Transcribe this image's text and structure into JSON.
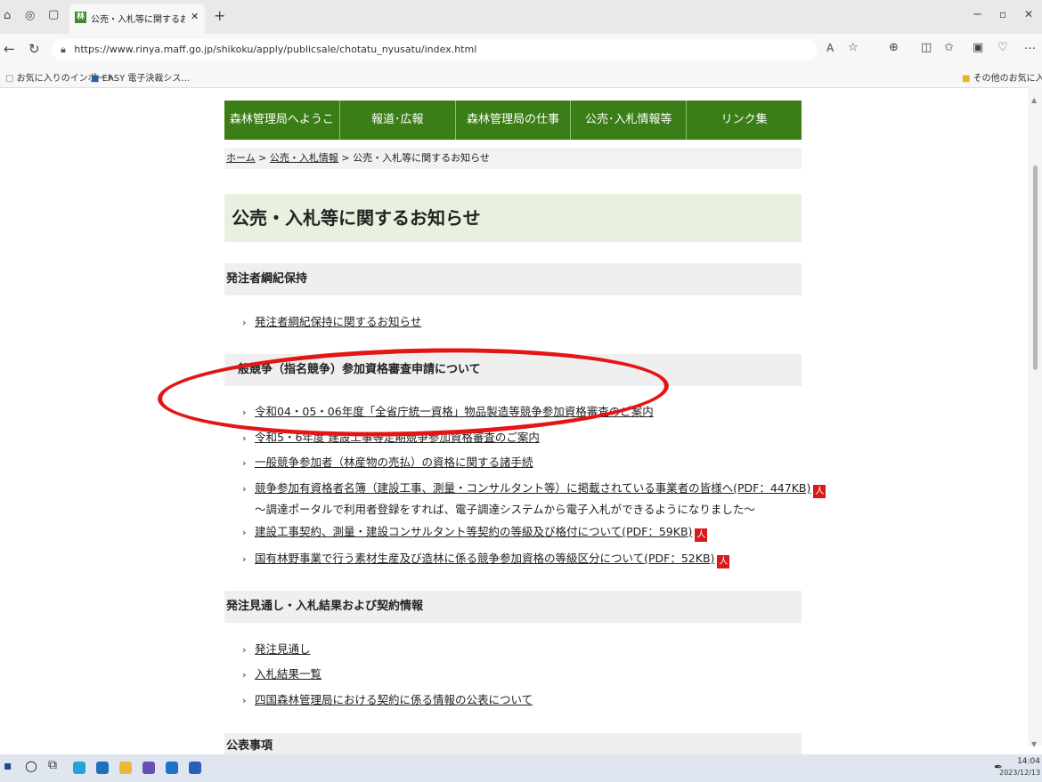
{
  "browser": {
    "tab_title": "公売・入札等に関するお知らせ：四国",
    "tab_favicon": "林",
    "url": "https://www.rinya.maff.go.jp/shikoku/apply/publicsale/chotatu_nyusatu/index.html",
    "favorites_import": "お気に入りのインポート",
    "favorites_easy": "EASY 電子決裁シス...",
    "favorites_other": "その他のお気に入り"
  },
  "nav": [
    "森林管理局へようこそ",
    "報道･広報",
    "森林管理局の仕事",
    "公売･入札情報等",
    "リンク集"
  ],
  "breadcrumb": {
    "home": "ホーム",
    "sep1": " > ",
    "level2": "公売・入札情報",
    "sep2": " > ",
    "current": "公売・入札等に関するお知らせ"
  },
  "page_title": "公売・入札等に関するお知らせ",
  "sections": {
    "s1": {
      "title": "発注者綱紀保持",
      "links": [
        "発注者綱紀保持に関するお知らせ"
      ]
    },
    "s2": {
      "title": "一般競争（指名競争）参加資格審査申請について",
      "links": [
        "令和04・05・06年度「全省庁統一資格」物品製造等競争参加資格審査のご案内",
        "令和5・6年度 建設工事等定期競争参加資格審査のご案内",
        "一般競争参加者（林産物の売払）の資格に関する諸手続",
        "競争参加有資格者名簿（建設工事、測量・コンサルタント等）に掲載されている事業者の皆様へ(PDF：447KB)",
        "建設工事契約、測量・建設コンサルタント等契約の等級及び格付について(PDF：59KB)",
        "国有林野事業で行う素材生産及び造林に係る競争参加資格の等級区分について(PDF：52KB)"
      ],
      "subtext": "～調達ポータルで利用者登録をすれば、電子調達システムから電子入札ができるようになりました～"
    },
    "s3": {
      "title": "発注見通し・入札結果および契約情報",
      "links": [
        "発注見通し",
        "入札結果一覧",
        "四国森林管理局における契約に係る情報の公表について"
      ]
    },
    "s4": {
      "title": "公表事項"
    }
  },
  "pdf_icon": "人",
  "taskbar": {
    "time": "14:04",
    "date": "2023/12/13"
  },
  "colors": {
    "nav_green": "#3b7d16",
    "annotation_red": "#e41515",
    "pdf_red": "#d71b1b"
  }
}
